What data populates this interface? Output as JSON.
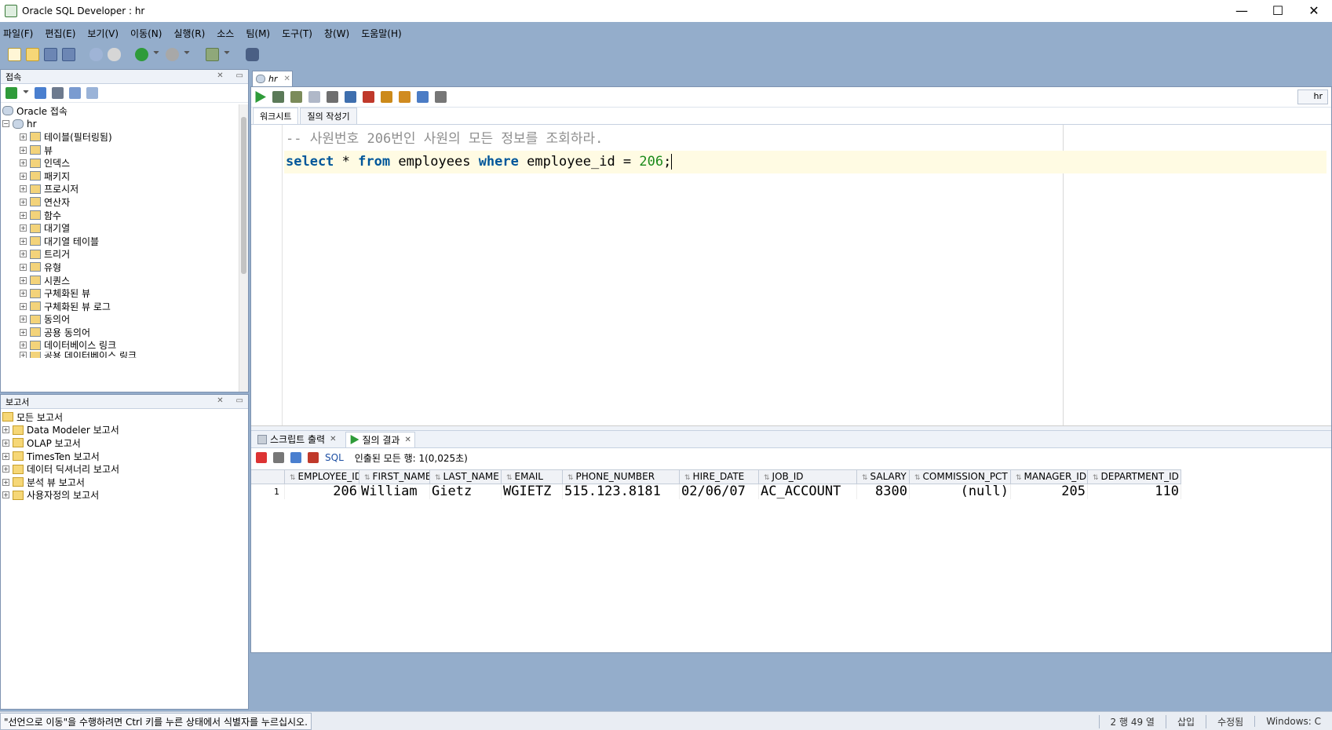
{
  "window": {
    "title": "Oracle SQL Developer : hr",
    "min": "—",
    "max": "☐",
    "close": "✕"
  },
  "menu": [
    "파일(F)",
    "편집(E)",
    "보기(V)",
    "이동(N)",
    "실행(R)",
    "소스",
    "팀(M)",
    "도구(T)",
    "창(W)",
    "도움말(H)"
  ],
  "connections_panel": {
    "title": "접속",
    "root": "Oracle 접속",
    "connection": "hr",
    "items": [
      "테이블(필터링됨)",
      "뷰",
      "인덱스",
      "패키지",
      "프로시저",
      "연산자",
      "함수",
      "대기열",
      "대기열 테이블",
      "트리거",
      "유형",
      "시퀀스",
      "구체화된 뷰",
      "구체화된 뷰 로그",
      "동의어",
      "공용 동의어",
      "데이터베이스 링크",
      "공용 데이터베이스 링크"
    ]
  },
  "reports_panel": {
    "title": "보고서",
    "root": "모든 보고서",
    "items": [
      "Data Modeler 보고서",
      "OLAP 보고서",
      "TimesTen 보고서",
      "데이터 딕셔너리 보고서",
      "분석 뷰 보고서",
      "사용자정의 보고서"
    ]
  },
  "editor": {
    "tab": "hr",
    "connection": "hr",
    "subtabs": [
      "워크시트",
      "질의 작성기"
    ],
    "comment": "-- 사원번호 206번인 사원의 모든 정보를 조회하라.",
    "sql": {
      "kw1": "select",
      "p1": " * ",
      "kw2": "from",
      "p2": " employees ",
      "kw3": "where",
      "p3": " employee_id = ",
      "num": "206",
      "p4": ";"
    }
  },
  "results": {
    "tabs": [
      "스크립트 출력",
      "질의 결과"
    ],
    "sql_label": "SQL",
    "status": "인출된 모든 행: 1(0,025초)",
    "columns": [
      "EMPLOYEE_ID",
      "FIRST_NAME",
      "LAST_NAME",
      "EMAIL",
      "PHONE_NUMBER",
      "HIRE_DATE",
      "JOB_ID",
      "SALARY",
      "COMMISSION_PCT",
      "MANAGER_ID",
      "DEPARTMENT_ID"
    ],
    "rows": [
      [
        "1",
        "206",
        "William",
        "Gietz",
        "WGIETZ",
        "515.123.8181",
        "02/06/07",
        "AC_ACCOUNT",
        "8300",
        "(null)",
        "205",
        "110"
      ]
    ]
  },
  "statusbar": {
    "message": "\"선언으로 이동\"을 수행하려면 Ctrl 키를 누른 상태에서 식별자를 누르십시오.",
    "position": "2 행 49 열",
    "mode": "삽입",
    "modified": "수정됨",
    "os": "Windows: C"
  }
}
